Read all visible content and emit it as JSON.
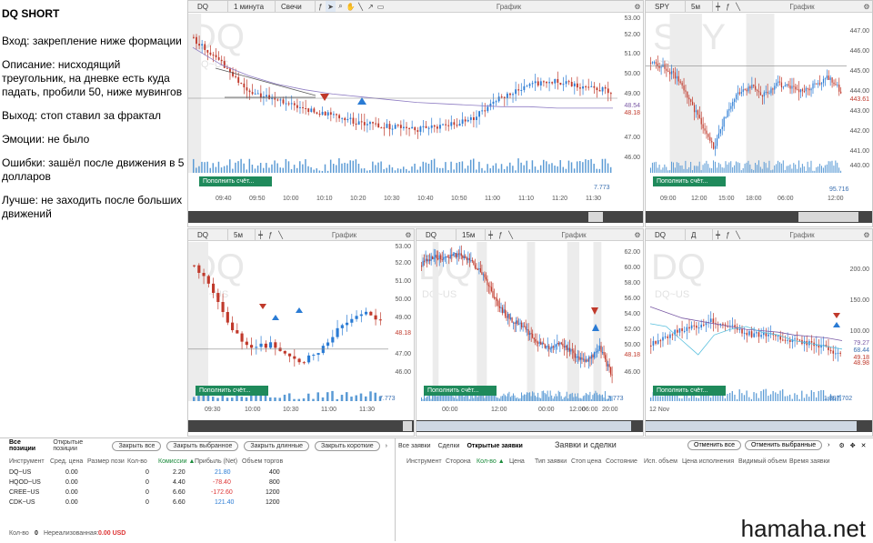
{
  "notes": {
    "title": "DQ SHORT",
    "lines": [
      "Вход: закрепление ниже формации",
      "Описание: нисходящий треугольник, на дневке есть куда падать, пробили 50, ниже мувингов",
      "Выход: стоп ставил за фрактал",
      "Эмоции: не было",
      "Ошибки: зашёл после движения в 5 долларов",
      "Лучше: не заходить после больших движений"
    ]
  },
  "panels": {
    "p1": {
      "symbol": "DQ",
      "timeframe": "1 минута",
      "type": "Свечи",
      "label": "График",
      "watermark": "DQ",
      "watermark_sub": "DQ~US",
      "yticks": [
        "53.00",
        "52.00",
        "51.00",
        "50.00",
        "49.00",
        "48.00",
        "47.00",
        "46.00"
      ],
      "xticks": [
        "09:40",
        "09:50",
        "10:00",
        "10:10",
        "10:20",
        "10:30",
        "10:40",
        "10:50",
        "11:00",
        "11:10",
        "11:20",
        "11:30"
      ],
      "price_labels": [
        {
          "value": "48.54",
          "color": "#7a5aa5"
        },
        {
          "value": "48.18",
          "color": "#c0392b"
        }
      ],
      "fund_label": "Пополнить счёт...",
      "volume_last": "7.773"
    },
    "p2": {
      "symbol": "SPY",
      "timeframe": "5м",
      "label": "График",
      "watermark": "SPY",
      "watermark_sub": "SPY~US",
      "yticks": [
        "447.00",
        "446.00",
        "445.00",
        "444.00",
        "443.00",
        "442.00",
        "441.00",
        "440.00"
      ],
      "xticks": [
        "09:00",
        "12:00",
        "15:00",
        "18:00",
        "06:00",
        "12:00"
      ],
      "price_labels": [
        {
          "value": "443.61",
          "color": "#c0392b"
        }
      ],
      "fund_label": "Пополнить счёт...",
      "volume_last": "95.716"
    },
    "p3": {
      "symbol": "DQ",
      "timeframe": "5м",
      "label": "График",
      "watermark": "DQ",
      "watermark_sub": "DQ~US",
      "yticks": [
        "53.00",
        "52.00",
        "51.00",
        "50.00",
        "49.00",
        "48.00",
        "47.00",
        "46.00"
      ],
      "xticks": [
        "09:30",
        "10:00",
        "10:30",
        "11:00",
        "11:30"
      ],
      "price_labels": [
        {
          "value": "48.18",
          "color": "#c0392b"
        }
      ],
      "fund_label": "Пополнить счёт...",
      "volume_last": "7.773"
    },
    "p4": {
      "symbol": "DQ",
      "timeframe": "15м",
      "label": "График",
      "watermark": "DQ",
      "watermark_sub": "DQ~US",
      "yticks": [
        "62.00",
        "60.00",
        "58.00",
        "56.00",
        "54.00",
        "52.00",
        "50.00",
        "48.00",
        "46.00"
      ],
      "xticks": [
        "00:00",
        "12:00",
        "00:00",
        "12:00",
        "06:00",
        "20:00"
      ],
      "price_labels": [
        {
          "value": "48.18",
          "color": "#c0392b"
        }
      ],
      "fund_label": "Пополнить счёт...",
      "volume_last": "7.773"
    },
    "p5": {
      "symbol": "DQ",
      "timeframe": "Д",
      "label": "График",
      "watermark": "DQ",
      "watermark_sub": "DQ~US",
      "yticks": [
        "200.00",
        "150.00",
        "100.00",
        "50.00"
      ],
      "xticks": [
        "12 Nov"
      ],
      "price_labels": [
        {
          "value": "79.27",
          "color": "#7a5aa5"
        },
        {
          "value": "68.44",
          "color": "#3a6fb0"
        },
        {
          "value": "49.18",
          "color": "#c0392b"
        },
        {
          "value": "48.98",
          "color": "#c0392b"
        }
      ],
      "fund_label": "Пополнить счёт...",
      "volume_last": "1.897.702"
    }
  },
  "positions": {
    "tabs": [
      "Все позиции",
      "Открытые позиции"
    ],
    "buttons": [
      "Закрыть все",
      "Закрыть выбранное",
      "Закрыть длинные",
      "Закрыть короткие"
    ],
    "columns": [
      "Инструмент",
      "Сред. цена",
      "Размер пози",
      "Кол-во",
      "Комиссии ▲",
      "Прибыль (Net)",
      "Объем торгов"
    ],
    "rows": [
      {
        "inst": "DQ~US",
        "avg": "0.00",
        "qty": "0",
        "comm": "2.20",
        "pnl": "21.80",
        "pnl_color": "#2a7bd4",
        "vol": "400"
      },
      {
        "inst": "HQOD~US",
        "avg": "0.00",
        "qty": "0",
        "comm": "4.40",
        "pnl": "-78.40",
        "pnl_color": "#d33",
        "vol": "800"
      },
      {
        "inst": "CREE~US",
        "avg": "0.00",
        "qty": "0",
        "comm": "6.60",
        "pnl": "-172.60",
        "pnl_color": "#d33",
        "vol": "1200"
      },
      {
        "inst": "CDK~US",
        "avg": "0.00",
        "qty": "0",
        "comm": "6.60",
        "pnl": "121.40",
        "pnl_color": "#2a7bd4",
        "vol": "1200"
      }
    ],
    "footer_qty_label": "Кол-во",
    "footer_qty": "0",
    "footer_unreal_label": "Нереализованная:",
    "footer_unreal": "0.00 USD"
  },
  "orders": {
    "tabs": [
      "Все заявки",
      "Сделки",
      "Открытые заявки"
    ],
    "title": "Заявки и сделки",
    "buttons": [
      "Отменить все",
      "Отменить выбранные"
    ],
    "columns": [
      "Инструмент",
      "Сторона",
      "Кол-во ▲",
      "Цена",
      "Тип заявки",
      "Стоп цена",
      "Состояние",
      "Исп. объем",
      "Цена исполнения",
      "Видимый объем",
      "Время заявки"
    ]
  },
  "brand": "hamaha.net"
}
